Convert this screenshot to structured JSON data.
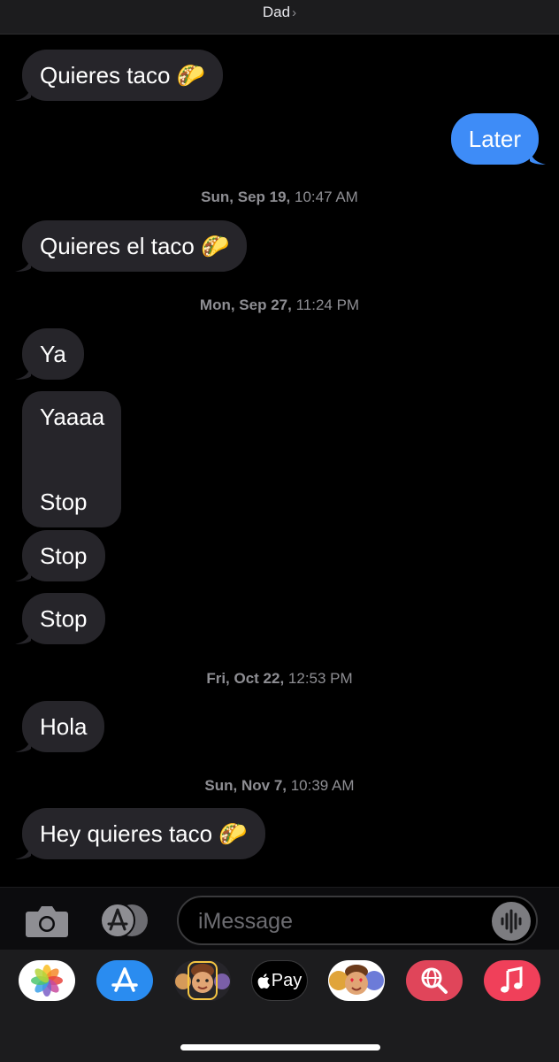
{
  "header": {
    "title": "Dad",
    "chevron": "›"
  },
  "messages": [
    {
      "type": "received",
      "text": "Quieres taco 🌮"
    },
    {
      "type": "sent",
      "text": "Later"
    },
    {
      "type": "timestamp",
      "day": "Sun, Sep 19,",
      "time": " 10:47 AM"
    },
    {
      "type": "received",
      "text": "Quieres el taco 🌮"
    },
    {
      "type": "timestamp",
      "day": "Mon, Sep 27,",
      "time": " 11:24 PM"
    },
    {
      "type": "received",
      "text": "Ya"
    },
    {
      "type": "received",
      "line1": "Yaaaa",
      "line2": "Stop"
    },
    {
      "type": "received",
      "text": "Stop"
    },
    {
      "type": "received",
      "text": "Stop"
    },
    {
      "type": "timestamp",
      "day": "Fri, Oct 22,",
      "time": " 12:53 PM"
    },
    {
      "type": "received",
      "text": "Hola"
    },
    {
      "type": "timestamp",
      "day": "Sun, Nov 7,",
      "time": " 10:39 AM"
    },
    {
      "type": "received",
      "text": "Hey quieres taco 🌮"
    }
  ],
  "input": {
    "placeholder": "iMessage"
  },
  "drawer": {
    "apple_pay_label": "Pay",
    "apps": [
      "photos-icon",
      "app-store-icon",
      "memoji-stickers-icon",
      "apple-pay-icon",
      "animoji-icon",
      "web-search-icon",
      "music-icon"
    ]
  },
  "colors": {
    "received_bubble": "#26252a",
    "sent_bubble": "#3e8cf7",
    "timestamp": "#8e8e93",
    "background": "#000000"
  }
}
